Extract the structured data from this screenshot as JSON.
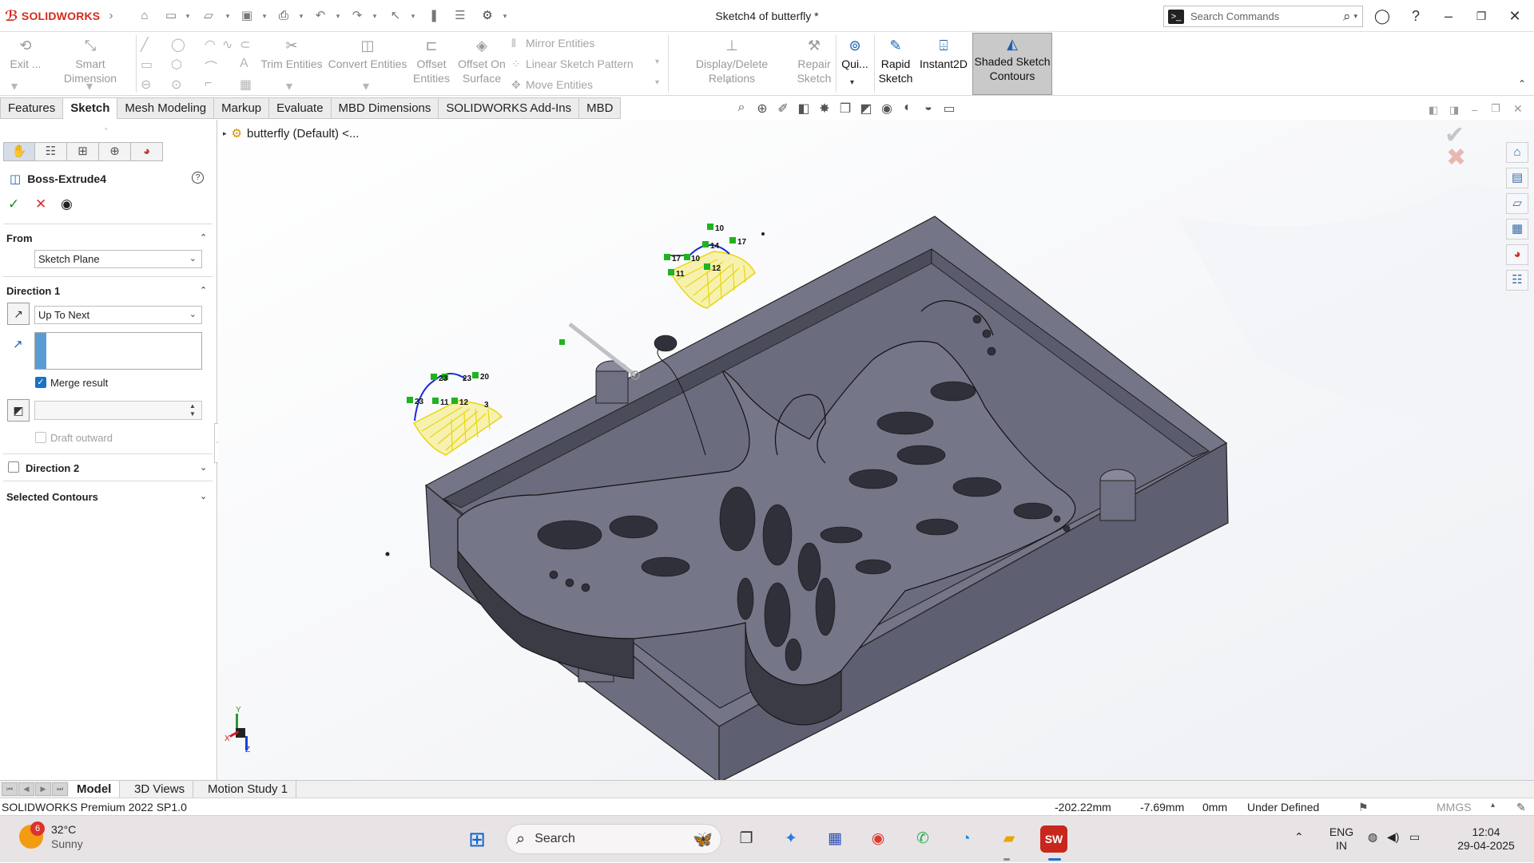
{
  "app": {
    "brand": "SOLIDWORKS",
    "document_title": "Sketch4 of butterfly *"
  },
  "search": {
    "placeholder": "Search Commands"
  },
  "command_manager": {
    "exit_label": "Exit ...",
    "smart_dimension": "Smart Dimension",
    "trim_entities": "Trim Entities",
    "convert_entities": "Convert Entities",
    "offset_entities_1": "Offset",
    "offset_entities_2": "Entities",
    "offset_on_surface_1": "Offset On",
    "offset_on_surface_2": "Surface",
    "mirror_entities": "Mirror Entities",
    "linear_sketch_pattern": "Linear Sketch Pattern",
    "move_entities": "Move Entities",
    "display_delete_relations": "Display/Delete Relations",
    "repair_sketch_1": "Repair",
    "repair_sketch_2": "Sketch",
    "quick_snaps": "Qui...",
    "rapid_sketch_1": "Rapid",
    "rapid_sketch_2": "Sketch",
    "instant2d": "Instant2D",
    "shaded_1": "Shaded Sketch",
    "shaded_2": "Contours"
  },
  "tabs": [
    {
      "label": "Features"
    },
    {
      "label": "Sketch",
      "active": true
    },
    {
      "label": "Mesh Modeling"
    },
    {
      "label": "Markup"
    },
    {
      "label": "Evaluate"
    },
    {
      "label": "MBD Dimensions"
    },
    {
      "label": "SOLIDWORKS Add-Ins"
    },
    {
      "label": "MBD"
    }
  ],
  "property_manager": {
    "title": "Boss-Extrude4",
    "from_label": "From",
    "from_value": "Sketch Plane",
    "direction1_label": "Direction 1",
    "direction1_value": "Up To Next",
    "merge_result": "Merge result",
    "merge_checked": true,
    "draft_outward": "Draft outward",
    "direction2_label": "Direction 2",
    "selected_contours": "Selected Contours"
  },
  "tree": {
    "root": "butterfly (Default) <..."
  },
  "sketch_labels": [
    "10",
    "14",
    "17",
    "17",
    "10",
    "12",
    "11",
    "23",
    "20",
    "23",
    "23",
    "11",
    "12",
    "3"
  ],
  "bottom_tabs": [
    {
      "label": "Model",
      "active": true
    },
    {
      "label": "3D Views"
    },
    {
      "label": "Motion Study 1"
    }
  ],
  "status": {
    "version": "SOLIDWORKS Premium 2022 SP1.0",
    "x": "-202.22mm",
    "y": "-7.69mm",
    "z": "0mm",
    "state": "Under Defined",
    "units": "MMGS"
  },
  "taskbar": {
    "weather_badge": "6",
    "temperature": "32°C",
    "condition": "Sunny",
    "search_label": "Search",
    "lang1": "ENG",
    "lang2": "IN",
    "time": "12:04",
    "date": "29-04-2025"
  },
  "triad": {
    "x": "X",
    "y": "Y",
    "z": "Z"
  },
  "colors": {
    "accent": "#1a73c5",
    "part_face": "#6e6f80",
    "sketch_yellow": "#f0e020",
    "sketch_blue": "#1a2bd8",
    "relation_green": "#1fb31f"
  }
}
